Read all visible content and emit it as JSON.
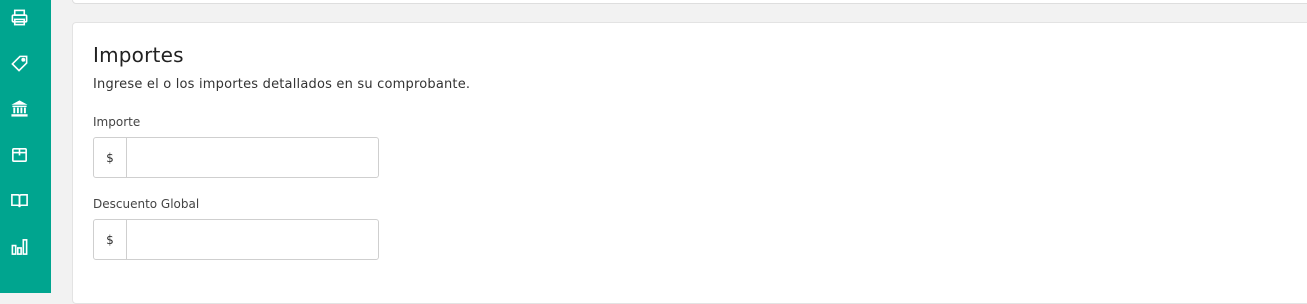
{
  "sidebar": {
    "color": "#00a58f",
    "icons": [
      "printer-icon",
      "tag-icon",
      "bank-icon",
      "box-icon",
      "book-icon",
      "bar-chart-icon"
    ]
  },
  "section": {
    "title": "Importes",
    "description": "Ingrese el o los importes detallados en su comprobante.",
    "fields": [
      {
        "label": "Importe",
        "prefix": "$",
        "value": ""
      },
      {
        "label": "Descuento Global",
        "prefix": "$",
        "value": ""
      }
    ]
  }
}
